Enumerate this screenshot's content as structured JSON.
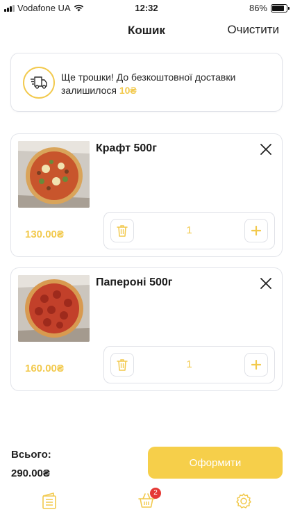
{
  "status_bar": {
    "carrier": "Vodafone UA",
    "time": "12:32",
    "battery_text": "86%",
    "battery_level": 0.86
  },
  "header": {
    "title": "Кошик",
    "clear_label": "Очистити"
  },
  "banner": {
    "text": "Ще трошки! До безкоштовної доставки залишилося ",
    "amount": "10₴",
    "icon": "delivery-truck-icon"
  },
  "items": [
    {
      "name": "Крафт 500г",
      "price": "130.00₴",
      "quantity": "1"
    },
    {
      "name": "Папероні 500г",
      "price": "160.00₴",
      "quantity": "1"
    }
  ],
  "summary": {
    "total_label": "Всього:",
    "total_value": "290.00₴",
    "checkout_label": "Оформити"
  },
  "tab_bar": {
    "tabs": [
      {
        "icon": "menu-list-icon"
      },
      {
        "icon": "cart-icon",
        "badge": "2"
      },
      {
        "icon": "settings-gear-icon"
      }
    ]
  },
  "colors": {
    "accent": "#f2c94c",
    "button": "#f6cf4a",
    "badge": "#e53935",
    "border": "#e2e4ea"
  }
}
